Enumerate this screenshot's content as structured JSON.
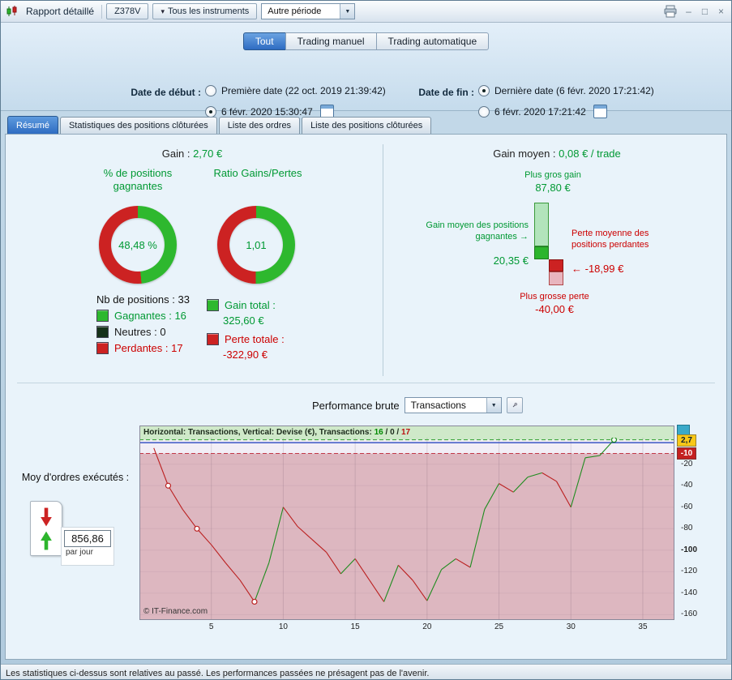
{
  "window": {
    "title": "Rapport détaillé",
    "toolbar": {
      "instrument_code": "Z378V",
      "instruments_label": "Tous les instruments",
      "period_value": "Autre période"
    },
    "controls": {
      "minimize": "–",
      "maximize": "□",
      "close": "×"
    }
  },
  "filters": {
    "mode_tabs": [
      {
        "label": "Tout",
        "selected": true
      },
      {
        "label": "Trading manuel",
        "selected": false
      },
      {
        "label": "Trading automatique",
        "selected": false
      }
    ],
    "date_start": {
      "label": "Date de début :",
      "option1": "Première date (22 oct. 2019 21:39:42)",
      "option2": "6 févr. 2020 15:30:47"
    },
    "date_end": {
      "label": "Date de fin :",
      "option1": "Dernière date (6 févr. 2020 17:21:42)",
      "option2": "6 févr. 2020 17:21:42"
    }
  },
  "tabs": [
    "Résumé",
    "Statistiques des positions clôturées",
    "Liste des ordres",
    "Liste des positions clôturées"
  ],
  "summary": {
    "gain_label": "Gain :",
    "gain_value": "2,70 €",
    "winpct_title": "% de positions gagnantes",
    "winpct_value": "48,48 %",
    "winpct_pct": 48.48,
    "ratio_title": "Ratio Gains/Pertes",
    "ratio_value": "1,01",
    "ratio_green_pct": 50.2,
    "donut_green": "#2eb82e",
    "donut_red": "#cc2222",
    "positions_label": "Nb de positions :",
    "positions_value": "33",
    "legend": [
      {
        "label": "Gagnantes :",
        "value": "16",
        "color": "#2eb82e"
      },
      {
        "label": "Neutres :",
        "value": "0",
        "color": "#16321a"
      },
      {
        "label": "Perdantes :",
        "value": "17",
        "color": "#cc2222"
      }
    ],
    "gain_total_label": "Gain total :",
    "gain_total_value": "325,60 €",
    "gain_total_color": "#2eb82e",
    "perte_total_label": "Perte totale :",
    "perte_total_value": "-322,90 €",
    "perte_total_color": "#cc2222"
  },
  "average": {
    "title_label": "Gain moyen :",
    "title_value": "0,08 € / trade",
    "max_gain_label": "Plus gros gain",
    "max_gain_value": "87,80 €",
    "avg_gain_label": "Gain moyen des positions gagnantes",
    "avg_gain_arrow": "→",
    "avg_gain_value": "20,35 €",
    "avg_loss_label": "Perte moyenne des positions perdantes",
    "avg_loss_arrow": "←",
    "avg_loss_value": "-18,99 €",
    "max_loss_label": "Plus grosse perte",
    "max_loss_value": "-40,00 €",
    "bar_values": {
      "max_gain": 87.8,
      "avg_gain": 20.35,
      "avg_loss": -18.99,
      "max_loss": -40
    }
  },
  "performance": {
    "label": "Performance brute",
    "select_value": "Transactions",
    "orders_label": "Moy d'ordres exécutés :",
    "orders_value": "856,86",
    "orders_unit": "par jour"
  },
  "chart_data": {
    "type": "line",
    "title": "Performance brute",
    "x_label": "Transactions",
    "y_label": "Devise (€)",
    "x_description": "transaction index 1..33",
    "values": [
      -5,
      -40,
      -62,
      -80,
      -95,
      -112,
      -128,
      -148,
      -112,
      -60,
      -78,
      -90,
      -102,
      -122,
      -108,
      -128,
      -148,
      -114,
      -128,
      -147,
      -118,
      -108,
      -116,
      -62,
      -38,
      -46,
      -32,
      -28,
      -36,
      -60,
      -14,
      -12,
      2.7
    ],
    "markers": [
      {
        "x": 2,
        "color": "#bb2020"
      },
      {
        "x": 4,
        "color": "#bb2020"
      },
      {
        "x": 8,
        "color": "#bb2020"
      },
      {
        "x": 33,
        "color": "#1e8c1e"
      }
    ],
    "x_ticks": [
      5,
      10,
      15,
      20,
      25,
      30,
      35
    ],
    "y_ticks": [
      -20,
      -40,
      -60,
      -80,
      -100,
      -120,
      -140,
      -160
    ],
    "ref_lines": {
      "final": 2.7,
      "zero": 0,
      "lower": -10
    },
    "badges": [
      {
        "text": "2,7",
        "value": 2.7,
        "bg": "#f8c818",
        "fg": "#102030"
      },
      {
        "text": "-10",
        "value": -10,
        "bg": "#c42020",
        "fg": "#ffffff"
      }
    ],
    "xlim": [
      0,
      37.2
    ],
    "ylim": [
      -165,
      16
    ],
    "grid": true,
    "legend_position": "none",
    "line_up_color": "#1e8c1e",
    "line_down_color": "#bb2020",
    "info": {
      "h_label": "Horizontal: ",
      "h_value": "Transactions",
      "sep1": ", ",
      "v_label": "Vertical: ",
      "v_value": "Devise (€)",
      "sep2": ", ",
      "t_label": "Transactions: ",
      "wins": "16",
      "slash1": " / ",
      "neutral": "0",
      "slash2": " / ",
      "losses": "17"
    },
    "copyright": "© IT-Finance.com"
  },
  "status_bar": "Les statistiques ci-dessus sont relatives au passé. Les performances passées ne présagent pas de l'avenir."
}
